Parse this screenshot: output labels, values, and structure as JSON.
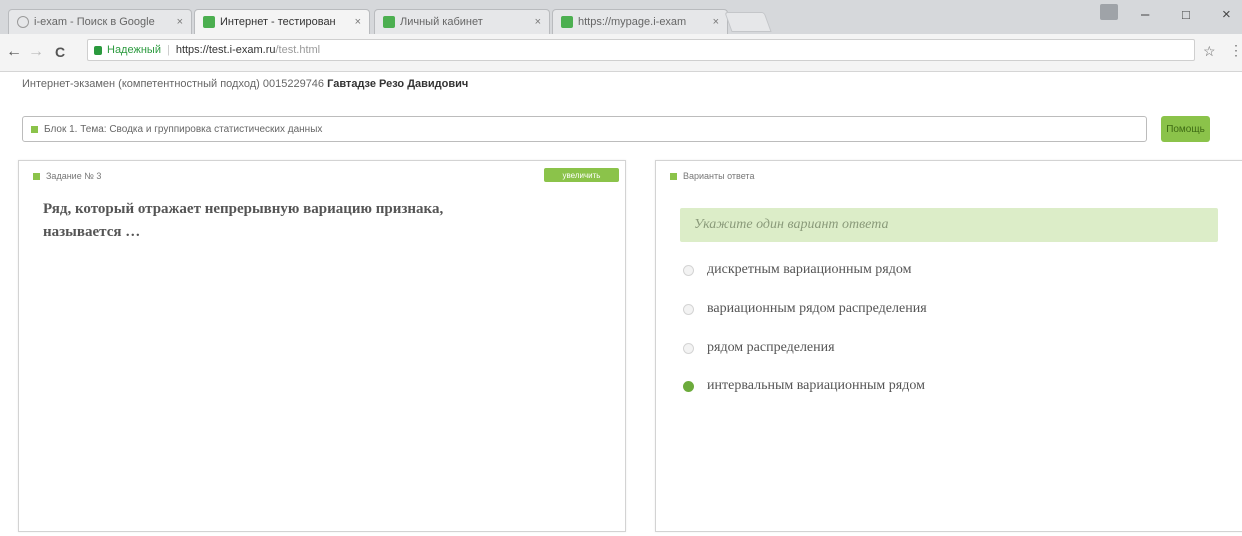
{
  "browser": {
    "tabs": [
      {
        "label": "i-exam - Поиск в Google",
        "close": "×"
      },
      {
        "label": "Интернет - тестирован",
        "close": "×"
      },
      {
        "label": "Личный кабинет",
        "close": "×"
      },
      {
        "label": "https://mypage.i-exam",
        "close": "×"
      }
    ],
    "window_controls": {
      "minimize": "–",
      "maximize": "□",
      "close": "×"
    },
    "nav": {
      "back": "←",
      "forward": "→",
      "reload": "C"
    },
    "address": {
      "secure_label": "Надежный",
      "separator": "|",
      "host": "https://test.i-exam.ru",
      "path": "/test.html"
    },
    "bookmark_star": "☆",
    "menu": "⋮"
  },
  "page": {
    "headline_prefix": "Интернет-экзамен (компетентностный подход) 0015229746",
    "student_name": "Гавтадзе Резо Давидович",
    "theme": "Блок 1. Тема: Сводка и группировка статистических данных",
    "help_button": "Помощь",
    "task": {
      "title": "Задание № 3",
      "zoom_button": "увеличить",
      "question": "Ряд, который отражает непрерывную вариацию признака, называется …"
    },
    "answers": {
      "title": "Варианты ответа",
      "hint": "Укажите один вариант ответа",
      "options": [
        {
          "label": "дискретным вариационным рядом",
          "selected": false
        },
        {
          "label": "вариационным рядом распределения",
          "selected": false
        },
        {
          "label": "рядом распределения",
          "selected": false
        },
        {
          "label": "интервальным вариационным рядом",
          "selected": true
        }
      ]
    }
  },
  "colors": {
    "accent": "#8bc34a",
    "selected_radio": "#6cab3c",
    "hint_bg": "#dcedc8"
  }
}
